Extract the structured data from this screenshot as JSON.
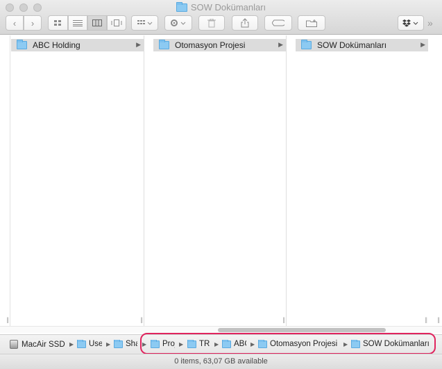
{
  "window": {
    "title": "SOW Dokümanları"
  },
  "toolbar": {
    "back_icon": "‹",
    "forward_icon": "›",
    "overflow_icon": "»"
  },
  "columns": [
    {
      "label": "ABC Holding"
    },
    {
      "label": "Otomasyon Projesi"
    },
    {
      "label": "SOW Dokümanları"
    }
  ],
  "pathbar": {
    "items": [
      {
        "label": "MacAir SSD"
      },
      {
        "label": "Users"
      },
      {
        "label": "Shared"
      },
      {
        "label": "Projects"
      },
      {
        "label": "TR"
      },
      {
        "label": "ABC Holding"
      },
      {
        "label": "Otomasyon Projesi"
      },
      {
        "label": "SOW Dokümanları"
      }
    ]
  },
  "status": {
    "text": "0 items, 63,07 GB available"
  },
  "colors": {
    "folder": "#8ccaf2",
    "selection_gray": "#dcdcdc",
    "highlight_ring": "#e0245e"
  }
}
